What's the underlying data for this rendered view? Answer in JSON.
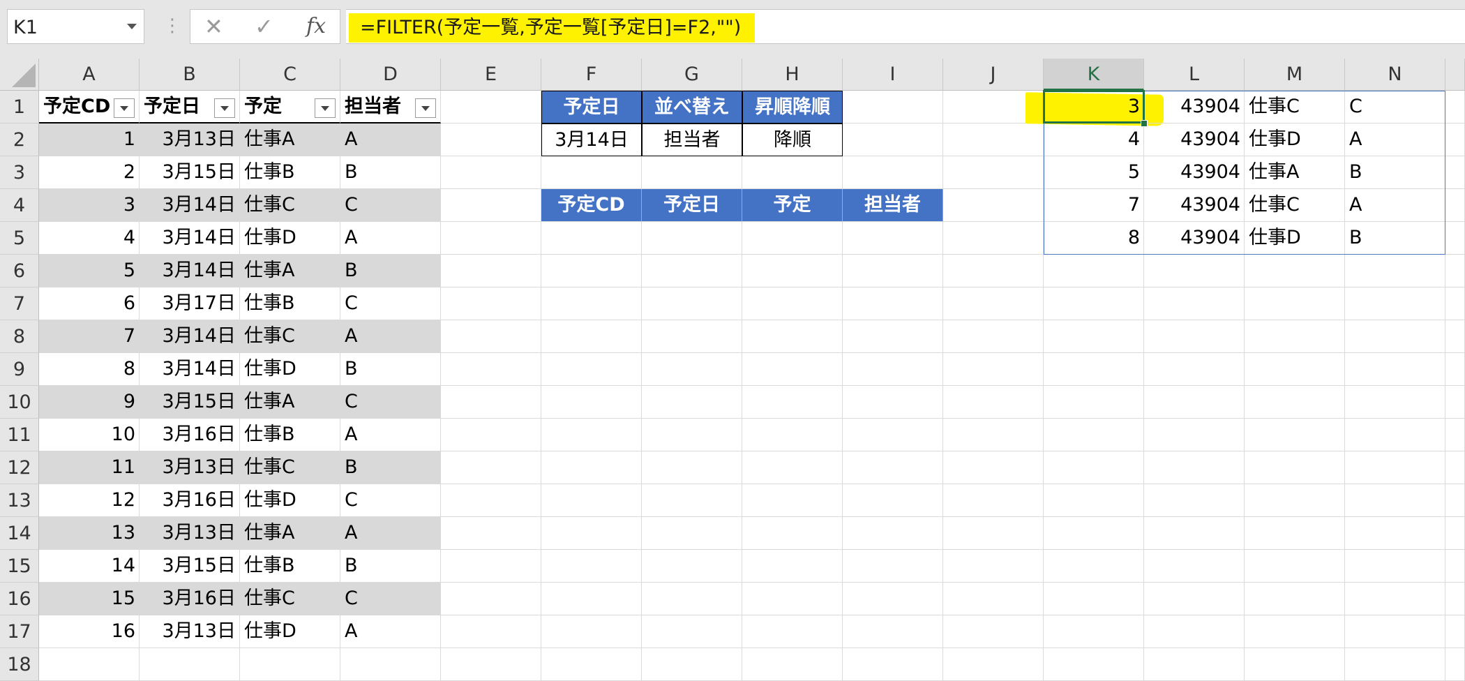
{
  "formula_bar": {
    "name_box": "K1",
    "separator": "⋮",
    "cancel_icon": "✕",
    "enter_icon": "✓",
    "fx_icon": "fx",
    "formula": "=FILTER(予定一覧,予定一覧[予定日]=F2,\"\")"
  },
  "columns": [
    "A",
    "B",
    "C",
    "D",
    "E",
    "F",
    "G",
    "H",
    "I",
    "J",
    "K",
    "L",
    "M",
    "N"
  ],
  "active_column": "K",
  "rows": [
    "1",
    "2",
    "3",
    "4",
    "5",
    "6",
    "7",
    "8",
    "9",
    "10",
    "11",
    "12",
    "13",
    "14",
    "15",
    "16",
    "17",
    "18"
  ],
  "table": {
    "headers": [
      "予定CD",
      "予定日",
      "予定",
      "担当者"
    ],
    "rows": [
      [
        "1",
        "3月13日",
        "仕事A",
        "A"
      ],
      [
        "2",
        "3月15日",
        "仕事B",
        "B"
      ],
      [
        "3",
        "3月14日",
        "仕事C",
        "C"
      ],
      [
        "4",
        "3月14日",
        "仕事D",
        "A"
      ],
      [
        "5",
        "3月14日",
        "仕事A",
        "B"
      ],
      [
        "6",
        "3月17日",
        "仕事B",
        "C"
      ],
      [
        "7",
        "3月14日",
        "仕事C",
        "A"
      ],
      [
        "8",
        "3月14日",
        "仕事D",
        "B"
      ],
      [
        "9",
        "3月15日",
        "仕事A",
        "C"
      ],
      [
        "10",
        "3月16日",
        "仕事B",
        "A"
      ],
      [
        "11",
        "3月13日",
        "仕事C",
        "B"
      ],
      [
        "12",
        "3月16日",
        "仕事D",
        "C"
      ],
      [
        "13",
        "3月13日",
        "仕事A",
        "A"
      ],
      [
        "14",
        "3月15日",
        "仕事B",
        "B"
      ],
      [
        "15",
        "3月16日",
        "仕事C",
        "C"
      ],
      [
        "16",
        "3月13日",
        "仕事D",
        "A"
      ]
    ]
  },
  "criteria": {
    "headers": [
      "予定日",
      "並べ替え",
      "昇順降順"
    ],
    "values": [
      "3月14日",
      "担当者",
      "降順"
    ]
  },
  "result_headers": [
    "予定CD",
    "予定日",
    "予定",
    "担当者"
  ],
  "spill": [
    [
      "3",
      "43904",
      "仕事C",
      "C"
    ],
    [
      "4",
      "43904",
      "仕事D",
      "A"
    ],
    [
      "5",
      "43904",
      "仕事A",
      "B"
    ],
    [
      "7",
      "43904",
      "仕事C",
      "A"
    ],
    [
      "8",
      "43904",
      "仕事D",
      "B"
    ]
  ],
  "colors": {
    "highlight": "#fff200",
    "table_header_blue": "#4472c4",
    "band_gray": "#d9d9d9",
    "active_green": "#217346"
  }
}
